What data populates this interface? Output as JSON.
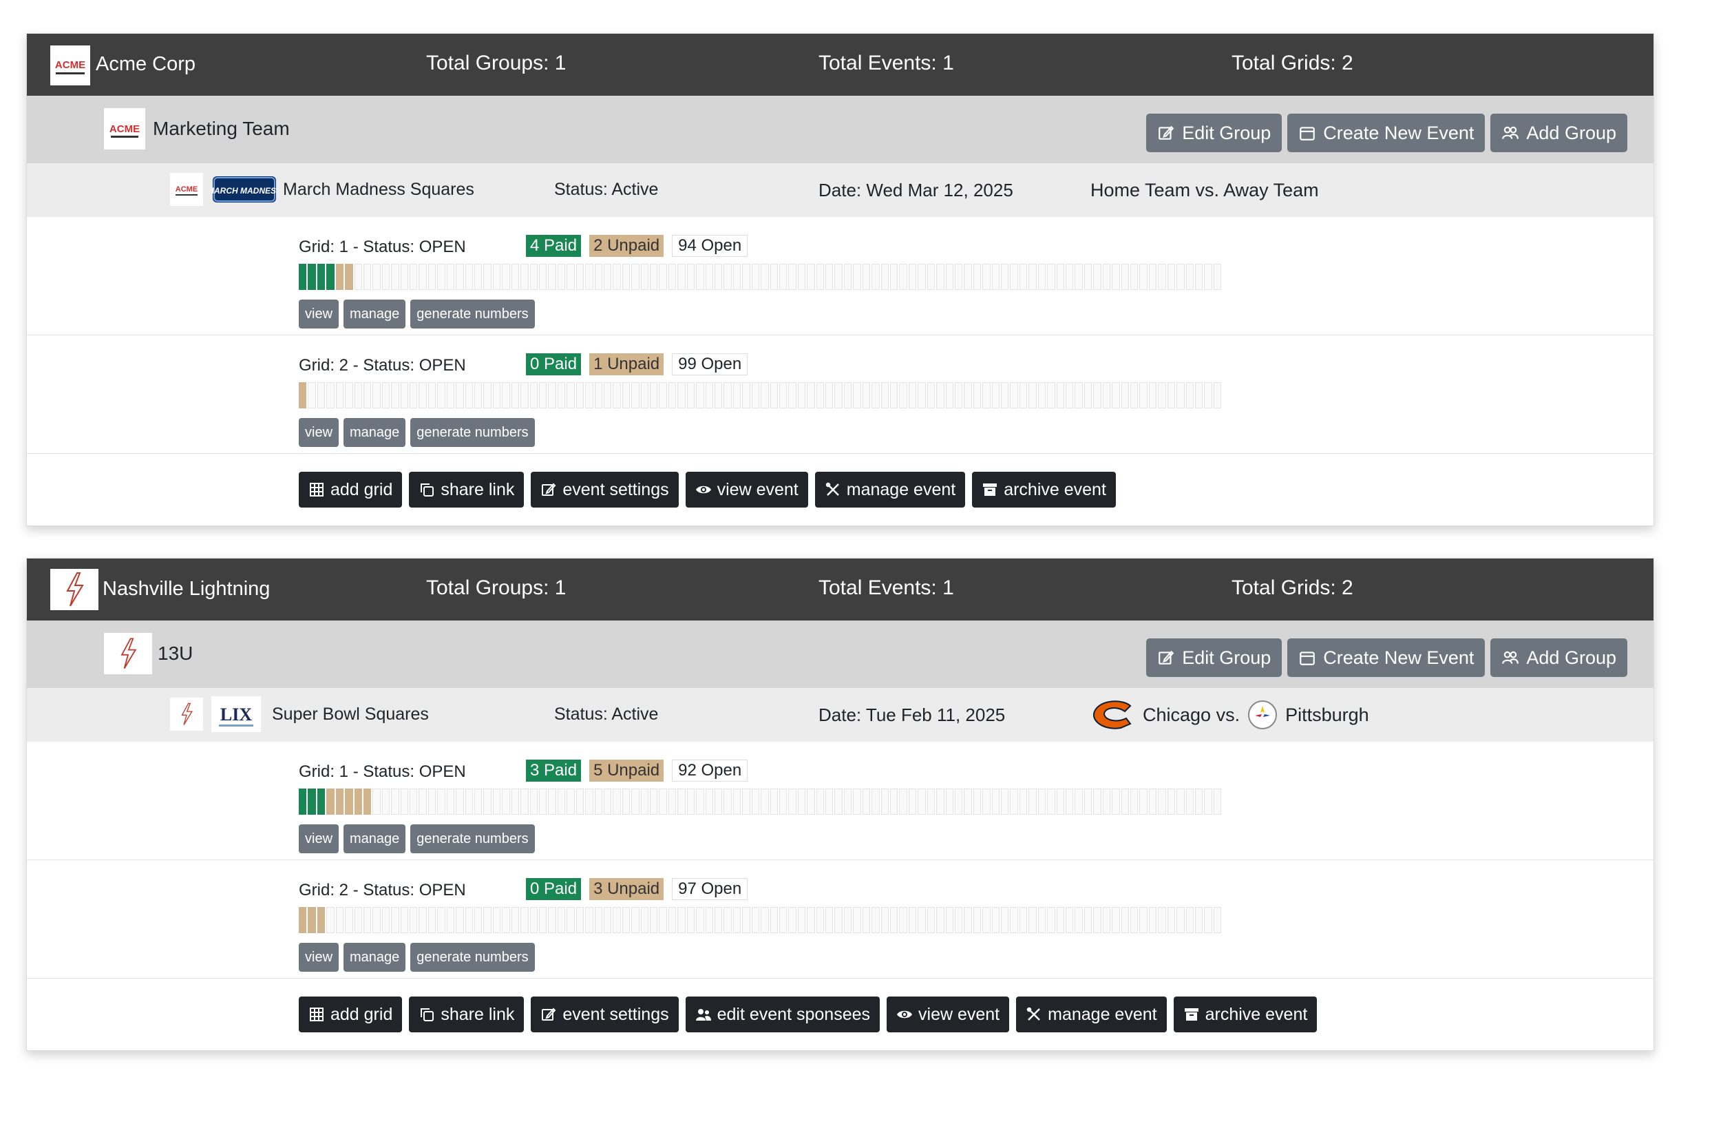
{
  "orgs": [
    {
      "name": "Acme Corp",
      "logo_text": "ACME",
      "stats": {
        "groups": "Total Groups: 1",
        "events": "Total Events: 1",
        "grids": "Total Grids: 2"
      },
      "group": {
        "name": "Marketing Team",
        "logo_text": "ACME",
        "actions": {
          "edit": "Edit Group",
          "create": "Create New Event",
          "add": "Add Group"
        }
      },
      "event": {
        "name": "March Madness Squares",
        "logo_text": "MARCH MADNESS",
        "status": "Status: Active",
        "date": "Date: Wed Mar 12, 2025",
        "home": "Home Team vs. Away Team",
        "away": ""
      },
      "grids": [
        {
          "title": "Grid: 1 - Status: OPEN",
          "paid_label": "4 Paid",
          "unpaid_label": "2 Unpaid",
          "open_label": "94 Open",
          "paid": 4,
          "unpaid": 2,
          "total": 100
        },
        {
          "title": "Grid: 2 - Status: OPEN",
          "paid_label": "0 Paid",
          "unpaid_label": "1 Unpaid",
          "open_label": "99 Open",
          "paid": 0,
          "unpaid": 1,
          "total": 100
        }
      ],
      "event_actions": [
        "add grid",
        "share link",
        "event settings",
        "view event",
        "manage event",
        "archive event"
      ]
    },
    {
      "name": "Nashville Lightning",
      "logo_text": "",
      "stats": {
        "groups": "Total Groups: 1",
        "events": "Total Events: 1",
        "grids": "Total Grids: 2"
      },
      "group": {
        "name": "13U",
        "logo_text": "",
        "actions": {
          "edit": "Edit Group",
          "create": "Create New Event",
          "add": "Add Group"
        }
      },
      "event": {
        "name": "Super Bowl Squares",
        "logo_text": "LIX",
        "status": "Status: Active",
        "date": "Date: Tue Feb 11, 2025",
        "home": "Chicago vs.",
        "away": "Pittsburgh"
      },
      "grids": [
        {
          "title": "Grid: 1 - Status: OPEN",
          "paid_label": "3 Paid",
          "unpaid_label": "5 Unpaid",
          "open_label": "92 Open",
          "paid": 3,
          "unpaid": 5,
          "total": 100
        },
        {
          "title": "Grid: 2 - Status: OPEN",
          "paid_label": "0 Paid",
          "unpaid_label": "3 Unpaid",
          "open_label": "97 Open",
          "paid": 0,
          "unpaid": 3,
          "total": 100
        }
      ],
      "event_actions": [
        "add grid",
        "share link",
        "event settings",
        "edit event sponsees",
        "view event",
        "manage event",
        "archive event"
      ]
    }
  ],
  "grid_actions": {
    "view": "view",
    "manage": "manage",
    "generate": "generate numbers"
  },
  "colors": {
    "header": "#3f3f3f",
    "paid": "#198754",
    "unpaid": "#d2b48c",
    "gray_button": "#6c757d",
    "dark_button": "#212529"
  }
}
